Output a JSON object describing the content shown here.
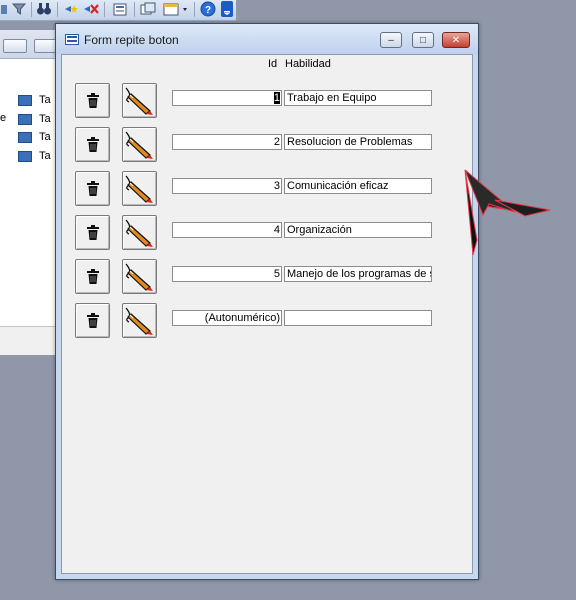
{
  "window": {
    "title": "Form repite boton",
    "minimize_label": "–",
    "restore_label": "□",
    "close_label": "✕"
  },
  "columns": {
    "id": "Id",
    "habilidad": "Habilidad"
  },
  "rows": [
    {
      "id": "1",
      "habilidad": "Trabajo en Equipo",
      "selected": true
    },
    {
      "id": "2",
      "habilidad": "Resolucion de Problemas"
    },
    {
      "id": "3",
      "habilidad": "Comunicación eficaz"
    },
    {
      "id": "4",
      "habilidad": "Organización"
    },
    {
      "id": "5",
      "habilidad": "Manejo de los programas de sof"
    },
    {
      "id": "(Autonumérico)",
      "habilidad": ""
    }
  ],
  "background_pane": {
    "items": [
      "Ta",
      "Ta",
      "Ta",
      "Ta"
    ],
    "cut_label": "e"
  },
  "icons": {
    "delete": "trash-icon",
    "edit": "pencil-edit-icon"
  },
  "colors": {
    "desktop": "#8f97a8",
    "client": "#f0f0f0",
    "titlebar": "#c7d7ee",
    "close_button": "#c2402f"
  }
}
